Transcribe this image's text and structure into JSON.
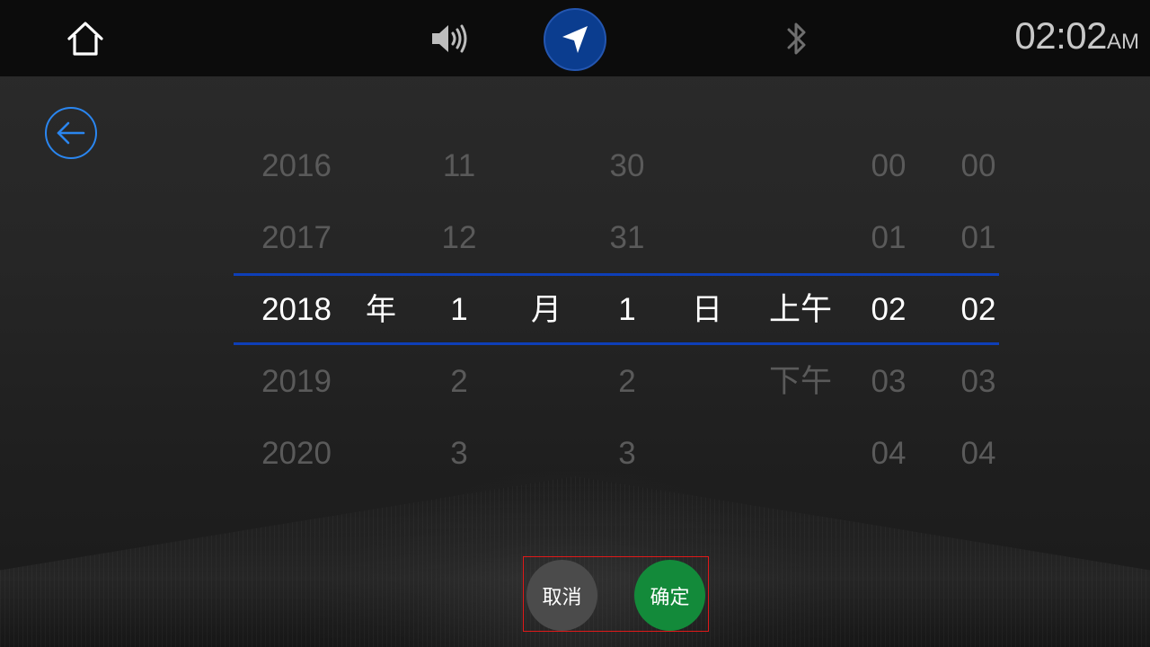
{
  "status_bar": {
    "clock_time": "02:02",
    "clock_ampm": "AM",
    "icons": [
      "home-icon",
      "volume-icon",
      "navigation-icon",
      "bluetooth-icon"
    ],
    "nav_accent": "#0b3d8f"
  },
  "picker": {
    "years": [
      "2016",
      "2017",
      "2018",
      "2019",
      "2020"
    ],
    "year_unit": "年",
    "months": [
      "11",
      "12",
      "1",
      "2",
      "3"
    ],
    "month_unit": "月",
    "days": [
      "30",
      "31",
      "1",
      "2",
      "3"
    ],
    "day_unit": "日",
    "ampm": [
      "",
      "",
      "上午",
      "下午",
      ""
    ],
    "hours": [
      "00",
      "01",
      "02",
      "03",
      "04"
    ],
    "minutes": [
      "00",
      "01",
      "02",
      "03",
      "04"
    ],
    "selected_index": 2,
    "selection_line_color": "#0e3fb8"
  },
  "actions": {
    "cancel_label": "取消",
    "confirm_label": "确定",
    "cancel_color": "#4b4b4b",
    "confirm_color": "#138a3a"
  },
  "back": {
    "icon": "back-arrow-icon",
    "color": "#2a86f0"
  }
}
